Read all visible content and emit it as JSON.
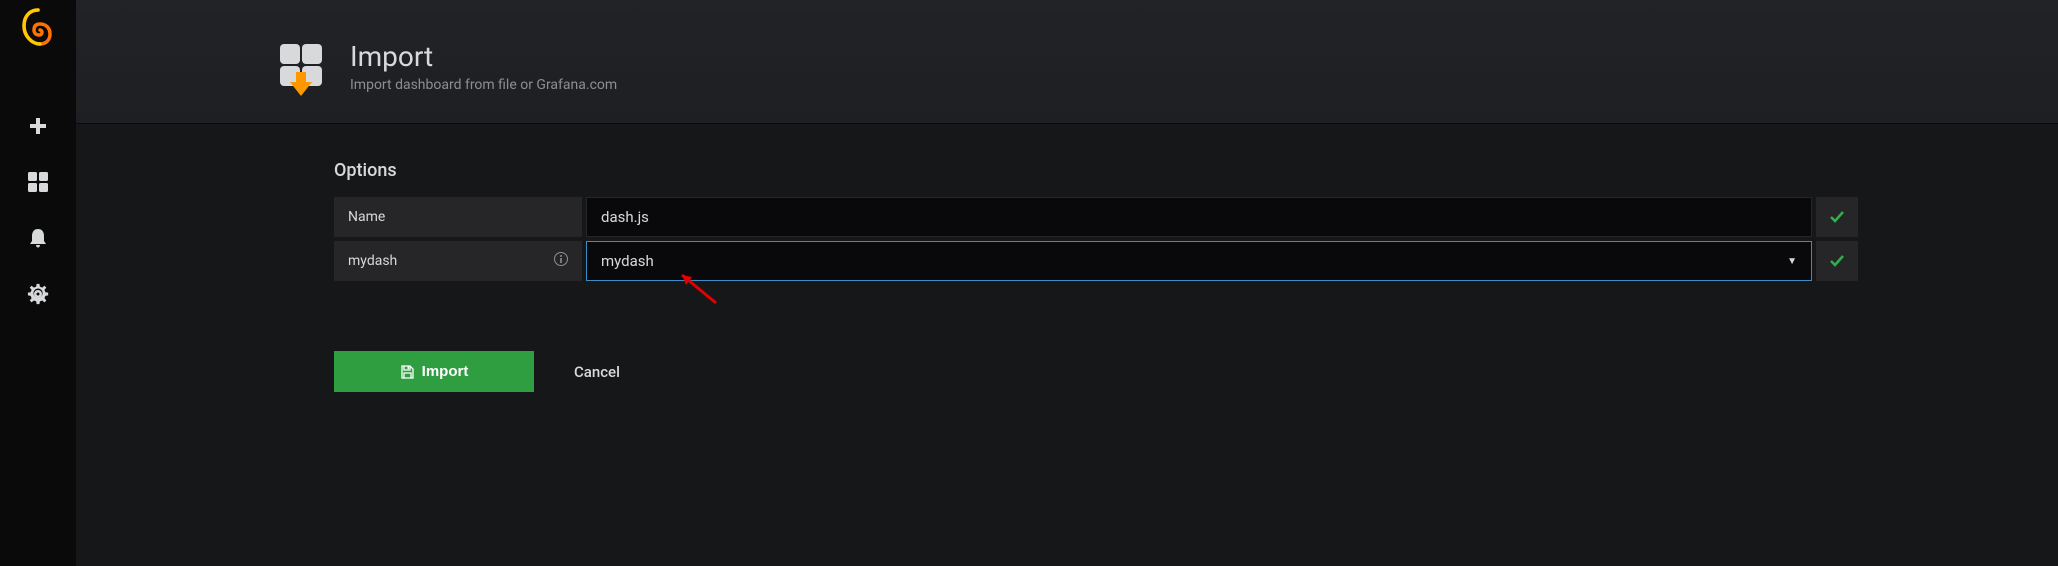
{
  "header": {
    "title": "Import",
    "subtitle": "Import dashboard from file or Grafana.com"
  },
  "options": {
    "title": "Options",
    "rows": [
      {
        "label": "Name",
        "value": "dash.js",
        "type": "text",
        "valid": true,
        "info": false
      },
      {
        "label": "mydash",
        "value": "mydash",
        "type": "select",
        "valid": true,
        "info": true
      }
    ]
  },
  "actions": {
    "import_label": "Import",
    "cancel_label": "Cancel"
  },
  "icons": {
    "plus": "plus-icon",
    "dashboards": "dashboards-icon",
    "bell": "bell-icon",
    "gear": "gear-icon"
  }
}
